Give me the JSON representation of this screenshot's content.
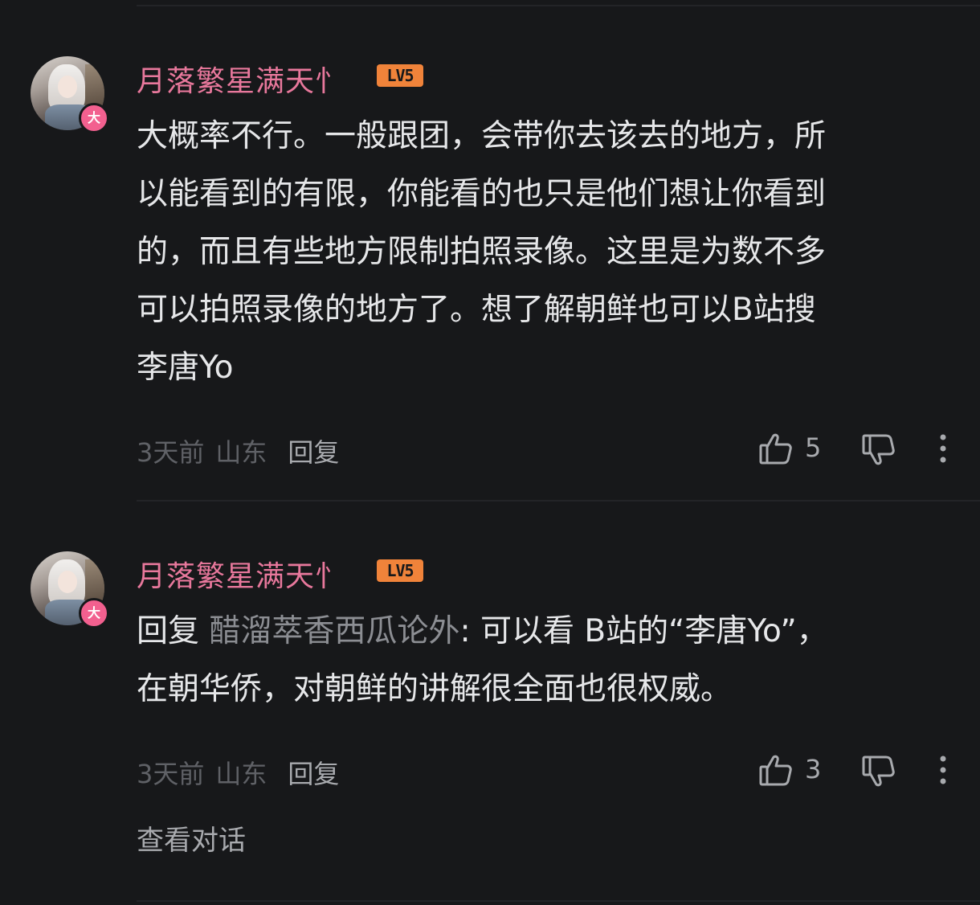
{
  "comments": [
    {
      "username": "月落繁星满天忄",
      "level": "LV5",
      "vip_badge": "大",
      "text_lines": [
        "大概率不行。一般跟团，会带你去该去的地方，所",
        "以能看到的有限，你能看的也只是他们想让你看到",
        "的，而且有些地方限制拍照录像。这里是为数不多",
        "可以拍照录像的地方了。想了解朝鲜也可以B站搜",
        "李唐Yo"
      ],
      "time": "3天前",
      "location": "山东",
      "reply_label": "回复",
      "likes": "5"
    },
    {
      "username": "月落繁星满天忄",
      "level": "LV5",
      "vip_badge": "大",
      "reply_prefix": "回复",
      "reply_to": "醋溜萃香西瓜论外",
      "text_line1": ": 可以看 B站的“李唐Yo”，",
      "text_line2": "在朝华侨，对朝鲜的讲解很全面也很权威。",
      "time": "3天前",
      "location": "山东",
      "reply_label": "回复",
      "likes": "3"
    }
  ],
  "view_thread_label": "查看对话",
  "colors": {
    "background": "#17181a",
    "username": "#e8789c",
    "level_badge": "#f0833a",
    "vip_badge": "#f2608f",
    "text": "#e6e7e9",
    "muted": "#5f6166",
    "secondary": "#a8aaae"
  },
  "icons": {
    "like": "thumbs-up-icon",
    "dislike": "thumbs-down-icon",
    "more": "more-vertical-icon"
  }
}
